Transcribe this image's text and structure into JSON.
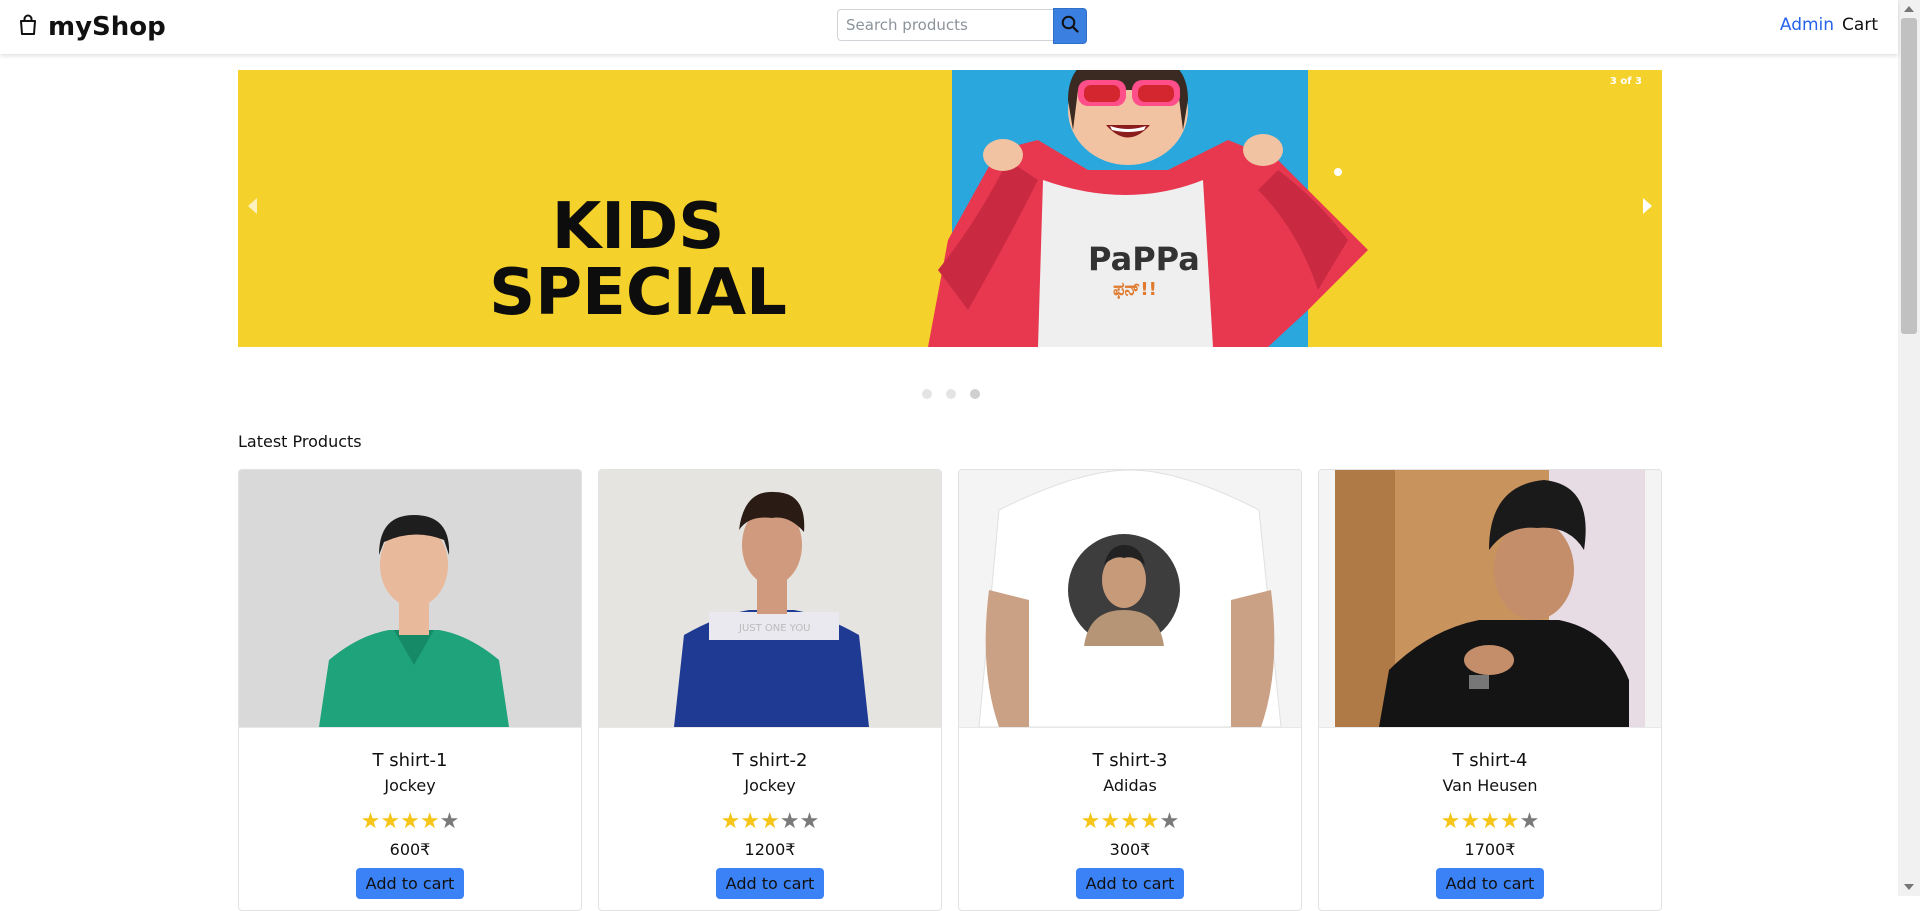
{
  "navbar": {
    "brand": "myShop",
    "search_placeholder": "Search products",
    "search_value": "",
    "admin_label": "Admin",
    "cart_label": "Cart"
  },
  "carousel": {
    "headline_line1": "KIDS",
    "headline_line2": "SPECIAL",
    "shirt_text": "PaPPa",
    "counter": "3 of 3",
    "slides": 3,
    "active_slide": 3
  },
  "section_title": "Latest Products",
  "products": [
    {
      "name": "T shirt-1",
      "brand": "Jockey",
      "price": "600₹",
      "rating": 4,
      "button": "Add to cart"
    },
    {
      "name": "T shirt-2",
      "brand": "Jockey",
      "price": "1200₹",
      "rating": 3,
      "button": "Add to cart"
    },
    {
      "name": "T shirt-3",
      "brand": "Adidas",
      "price": "300₹",
      "rating": 4,
      "button": "Add to cart"
    },
    {
      "name": "T shirt-4",
      "brand": "Van Heusen",
      "price": "1700₹",
      "rating": 4,
      "button": "Add to cart"
    }
  ],
  "colors": {
    "banner_yellow": "#f5d12b",
    "banner_blue": "#2aa7dc",
    "accent_blue": "#3b82f6",
    "star": "#f5c518",
    "admin_link": "#2563eb"
  },
  "icons": {
    "brand": "shopping-bag-icon",
    "search": "search-icon"
  }
}
